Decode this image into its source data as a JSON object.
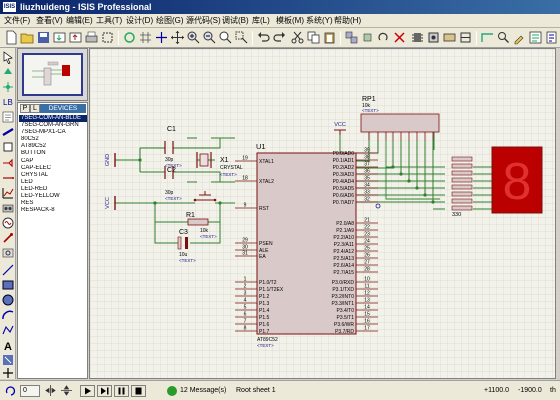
{
  "titlebar": {
    "icon_text": "ISIS",
    "title": "liuzhuideng - ISIS Professional"
  },
  "menu": [
    {
      "label": "文件(F)"
    },
    {
      "label": "查看(V)"
    },
    {
      "label": "编辑(E)"
    },
    {
      "label": "工具(T)"
    },
    {
      "label": "设计(D)"
    },
    {
      "label": "绘图(G)"
    },
    {
      "label": "源代码(S)"
    },
    {
      "label": "调试(B)"
    },
    {
      "label": "库(L)"
    },
    {
      "label": "模板(M)"
    },
    {
      "label": "系统(Y)"
    },
    {
      "label": "帮助(H)"
    }
  ],
  "device_panel": {
    "p_button": "P",
    "l_button": "L",
    "header": "DEVICES",
    "items": [
      "7SEG-COM-AN-BLUE",
      "7SEG-COM-AN-GRN",
      "7SEG-MPX1-CA",
      "80C52",
      "AT89C52",
      "BUTTON",
      "CAP",
      "CAP-ELEC",
      "CRYSTAL",
      "LED",
      "LED-RED",
      "LED-YELLOW",
      "RES",
      "RESPACK-8"
    ],
    "selected_index": 0
  },
  "schematic": {
    "c1": {
      "ref": "C1",
      "value": "30p",
      "text": "<TEXT>"
    },
    "c2": {
      "ref": "C2",
      "value": "30p",
      "text": "<TEXT>"
    },
    "x1": {
      "ref": "X1",
      "value": "CRYSTAL",
      "text": "<TEXT>"
    },
    "r1": {
      "ref": "R1",
      "value": "10k",
      "text": "<TEXT>"
    },
    "c3": {
      "ref": "C3",
      "value": "10u",
      "text": "<TEXT>"
    },
    "rp1": {
      "ref": "RP1",
      "value": "10k",
      "text": "<TEXT>"
    },
    "gnd_label": "GND",
    "vcc_label": "VCC",
    "u1": {
      "ref": "U1",
      "part": "AT89C52",
      "text": "<TEXT>",
      "left_pins": [
        {
          "num": "19",
          "name": "XTAL1"
        },
        {
          "num": "18",
          "name": "XTAL2"
        },
        {
          "num": "9",
          "name": "RST"
        },
        {
          "num": "29",
          "name": "PSEN"
        },
        {
          "num": "30",
          "name": "ALE"
        },
        {
          "num": "31",
          "name": "EA"
        },
        {
          "num": "1",
          "name": "P1.0/T2"
        },
        {
          "num": "2",
          "name": "P1.1/T2EX"
        },
        {
          "num": "3",
          "name": "P1.2"
        },
        {
          "num": "4",
          "name": "P1.3"
        },
        {
          "num": "5",
          "name": "P1.4"
        },
        {
          "num": "6",
          "name": "P1.5"
        },
        {
          "num": "7",
          "name": "P1.6"
        },
        {
          "num": "8",
          "name": "P1.7"
        }
      ],
      "right_pins": [
        {
          "num": "39",
          "name": "P0.0/AD0"
        },
        {
          "num": "38",
          "name": "P0.1/AD1"
        },
        {
          "num": "37",
          "name": "P0.2/AD2"
        },
        {
          "num": "36",
          "name": "P0.3/AD3"
        },
        {
          "num": "35",
          "name": "P0.4/AD4"
        },
        {
          "num": "34",
          "name": "P0.5/AD5"
        },
        {
          "num": "33",
          "name": "P0.6/AD6"
        },
        {
          "num": "32",
          "name": "P0.7/AD7"
        },
        {
          "num": "21",
          "name": "P2.0/A8"
        },
        {
          "num": "22",
          "name": "P2.1/A9"
        },
        {
          "num": "23",
          "name": "P2.2/A10"
        },
        {
          "num": "24",
          "name": "P2.3/A11"
        },
        {
          "num": "25",
          "name": "P2.4/A12"
        },
        {
          "num": "26",
          "name": "P2.5/A13"
        },
        {
          "num": "27",
          "name": "P2.6/A14"
        },
        {
          "num": "28",
          "name": "P2.7/A15"
        },
        {
          "num": "10",
          "name": "P3.0/RXD"
        },
        {
          "num": "11",
          "name": "P3.1/TXD"
        },
        {
          "num": "12",
          "name": "P3.2/INT0"
        },
        {
          "num": "13",
          "name": "P3.3/INT1"
        },
        {
          "num": "14",
          "name": "P3.4/T0"
        },
        {
          "num": "15",
          "name": "P3.5/T1"
        },
        {
          "num": "16",
          "name": "P3.6/WR"
        },
        {
          "num": "17",
          "name": "P3.7/RD"
        }
      ]
    },
    "resistor_block_label": "330",
    "seg_digit": "8",
    "colors": {
      "wire": "#2f7f2f",
      "component": "#7a1010",
      "body": "#d9c9c9",
      "label": "#1a1a8a",
      "seg_display": "#bb0000"
    }
  },
  "status": {
    "rotation_value": "0",
    "messages": "12 Message(s)",
    "sheet": "Root sheet 1",
    "x_coord": "+1100.0",
    "y_coord": "-1900.0",
    "unit": "th"
  }
}
